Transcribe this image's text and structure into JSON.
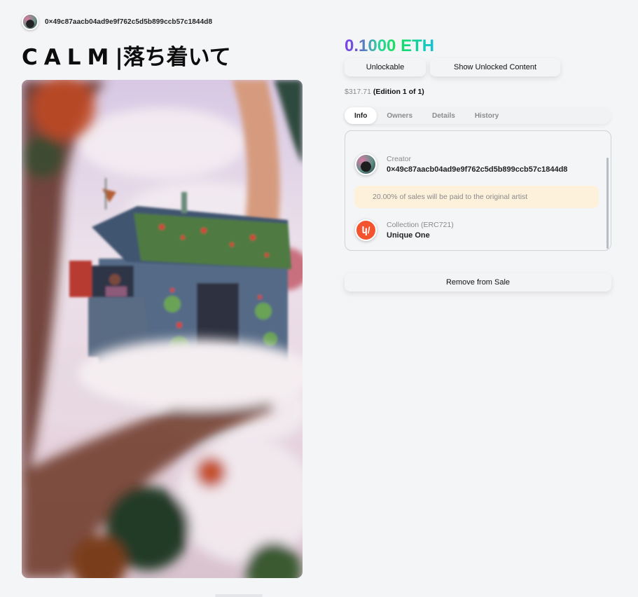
{
  "owner": {
    "address": "0×49c87aacb04ad9e9f762c5d5b899ccb57c1844d8"
  },
  "title": {
    "latin": "CALM",
    "separator": "|",
    "japanese": "落ち着いて"
  },
  "price": {
    "amount": "0.1000 ETH",
    "usd": "$317.71",
    "edition": "(Edition 1 of 1)"
  },
  "buttons": {
    "unlockable": "Unlockable",
    "show_unlocked": "Show Unlocked Content",
    "remove_from_sale": "Remove from Sale"
  },
  "tabs": [
    {
      "label": "Info",
      "active": true
    },
    {
      "label": "Owners",
      "active": false
    },
    {
      "label": "Details",
      "active": false
    },
    {
      "label": "History",
      "active": false
    }
  ],
  "info": {
    "creator_label": "Creator",
    "creator_address": "0×49c87aacb04ad9e9f762c5d5b899ccb57c1844d8",
    "royalty_note": "20.00% of sales will be paid to the original artist",
    "collection_label": "Collection (ERC721)",
    "collection_name": "Unique One",
    "collection_logo": "unique-one-logo",
    "collection_logo_text": "կ/"
  },
  "colors": {
    "accent_purple": "#7b3ff2",
    "accent_green": "#16e05a",
    "royalty_bg": "#fdf1dc",
    "collection_logo_bg": "#f3532f"
  }
}
